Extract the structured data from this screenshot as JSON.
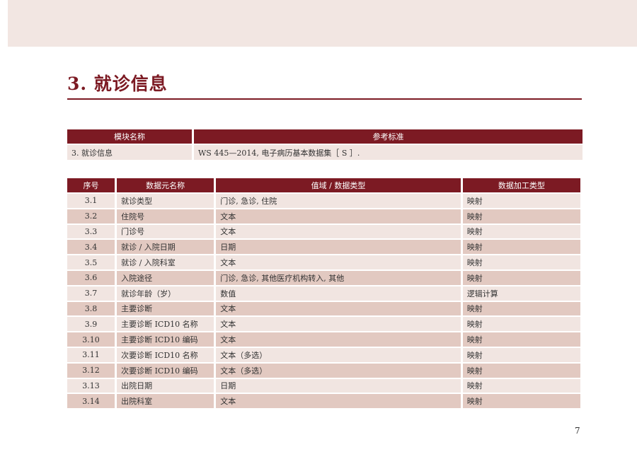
{
  "heading": "3. 就诊信息",
  "module_table": {
    "headers": [
      "模块名称",
      "参考标准"
    ],
    "row": [
      "3. 就诊信息",
      "WS 445—2014, 电子病历基本数据集［ S ］."
    ]
  },
  "elements_table": {
    "headers": [
      "序号",
      "数据元名称",
      "值域 / 数据类型",
      "数据加工类型"
    ],
    "rows": [
      [
        "3.1",
        "就诊类型",
        "门诊, 急诊, 住院",
        "映射"
      ],
      [
        "3.2",
        "住院号",
        "文本",
        "映射"
      ],
      [
        "3.3",
        "门诊号",
        "文本",
        "映射"
      ],
      [
        "3.4",
        "就诊 / 入院日期",
        "日期",
        "映射"
      ],
      [
        "3.5",
        "就诊 / 入院科室",
        "文本",
        "映射"
      ],
      [
        "3.6",
        "入院途径",
        "门诊, 急诊, 其他医疗机构转入, 其他",
        "映射"
      ],
      [
        "3.7",
        "就诊年龄（岁）",
        "数值",
        "逻辑计算"
      ],
      [
        "3.8",
        "主要诊断",
        "文本",
        "映射"
      ],
      [
        "3.9",
        "主要诊断 ICD10 名称",
        "文本",
        "映射"
      ],
      [
        "3.10",
        "主要诊断 ICD10 编码",
        "文本",
        "映射"
      ],
      [
        "3.11",
        "次要诊断 ICD10 名称",
        "文本（多选）",
        "映射"
      ],
      [
        "3.12",
        "次要诊断 ICD10 编码",
        "文本（多选）",
        "映射"
      ],
      [
        "3.13",
        "出院日期",
        "日期",
        "映射"
      ],
      [
        "3.14",
        "出院科室",
        "文本",
        "映射"
      ]
    ]
  },
  "page_number": "7",
  "colors": {
    "accent": "#7c1a23",
    "row_light": "#f1e5e1",
    "row_dark": "#e2c9c1",
    "top_band": "#f2e6e2"
  }
}
